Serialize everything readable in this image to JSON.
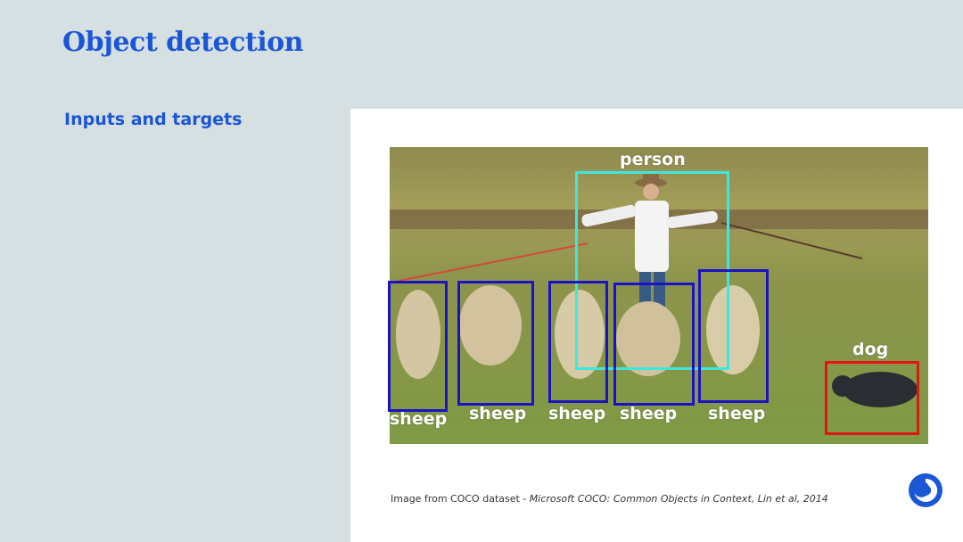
{
  "slide": {
    "title": "Object detection",
    "subtitle": "Inputs and targets"
  },
  "image": {
    "labels": {
      "person": "person",
      "dog": "dog",
      "sheep_1": "sheep",
      "sheep_2": "sheep",
      "sheep_3": "sheep",
      "sheep_4": "sheep",
      "sheep_5": "sheep"
    },
    "colors": {
      "sheep_box": "#1b12c8",
      "person_box": "#3fe6e0",
      "dog_box": "#e01616"
    }
  },
  "caption": {
    "prefix": "Image from COCO dataset - ",
    "citation": "Microsoft COCO: Common Objects in Context, Lin et al, 2014"
  },
  "logo": {
    "icon": "deepmind-logo-icon"
  }
}
